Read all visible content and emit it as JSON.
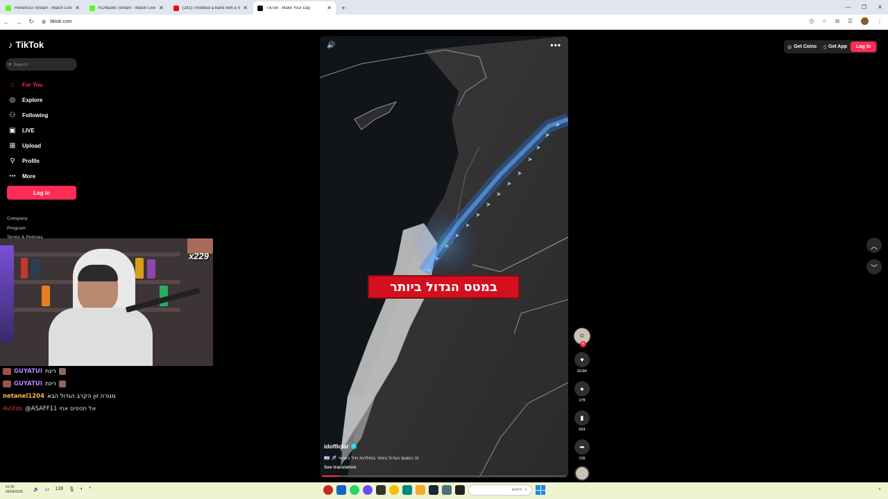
{
  "browser": {
    "tabs": [
      {
        "title": "RonenGG Stream - Watch Live o",
        "favicon_color": "#53fc18"
      },
      {
        "title": "KOnkaMc Stream - Watch Live o",
        "favicon_color": "#53fc18"
      },
      {
        "title": "(281) I Robbed a Bank with a St",
        "favicon_color": "#ff0000"
      },
      {
        "title": "TikTok - Make Your Day",
        "favicon_color": "#000000",
        "active": true
      }
    ],
    "new_tab": "+",
    "url": "tiktok.com"
  },
  "tiktok": {
    "logo": "TikTok",
    "search_placeholder": "Search",
    "nav": [
      {
        "label": "For You",
        "icon": "home-icon",
        "active": true
      },
      {
        "label": "Explore",
        "icon": "compass-icon"
      },
      {
        "label": "Following",
        "icon": "following-icon"
      },
      {
        "label": "LIVE",
        "icon": "live-icon"
      },
      {
        "label": "Upload",
        "icon": "upload-icon"
      },
      {
        "label": "Profile",
        "icon": "profile-icon"
      },
      {
        "label": "More",
        "icon": "more-icon"
      }
    ],
    "login_label": "Log in",
    "footer_links": [
      "Company",
      "Program",
      "Terms & Policies"
    ],
    "top_right": {
      "get_coins": "Get Coins",
      "get_app": "Get App",
      "login": "Log in"
    }
  },
  "video": {
    "caption_overlay": "במטס הגדול ביותר",
    "username": "idofficial",
    "description": "זה המטס הגדול ביותר בתולדות חיל האוויר ✈️ 🇮🇱",
    "see_translation": "See translation",
    "progress": 0.07,
    "likes": "19.5K",
    "comments": "179",
    "bookmarks": "624",
    "shares": "725"
  },
  "stream": {
    "gift_counter": "x229",
    "chat": [
      {
        "user": "GUYATUI",
        "message": "רינת",
        "user_color": "#b388ff"
      },
      {
        "user": "GUYATUI",
        "message": "רינת",
        "user_color": "#b388ff"
      },
      {
        "user": "netanel1204",
        "message": "מנורה זון הקרב הגדול הבא",
        "user_color": "#ffb74d"
      },
      {
        "user": "AviXos",
        "message": "@ASAFF11 אל תספים אחי",
        "user_color": "#e53935"
      }
    ]
  },
  "taskbar": {
    "time": "01:25",
    "date": "09/04/2026",
    "volume_text": "139",
    "search_text": "חיפוש"
  }
}
